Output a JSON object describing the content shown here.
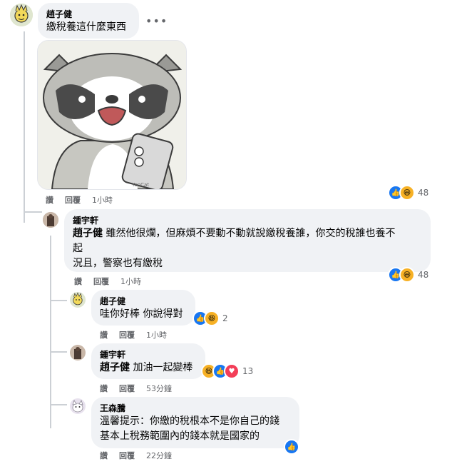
{
  "colors": {
    "like": "#1877f2",
    "haha": "#f7b125",
    "bubble": "#f0f2f5",
    "meta": "#65676b"
  },
  "comments": [
    {
      "author": "趙子健",
      "text": "繳稅養這什麼東西",
      "actions": {
        "like": "讚",
        "reply": "回覆",
        "time": "1小時"
      },
      "reactions": "48"
    },
    {
      "author": "鍾宇軒",
      "mention": "趙子健",
      "line1": "雖然他很爛，但麻煩不要動不動就說繳稅養誰，你交的稅誰也養不",
      "line2": "起",
      "line3": "況且，警察也有繳稅",
      "actions": {
        "like": "讚",
        "reply": "回覆",
        "time": "1小時"
      },
      "reactions": "48"
    },
    {
      "author": "趙子健",
      "text": "哇你好棒 你說得對",
      "actions": {
        "like": "讚",
        "reply": "回覆",
        "time": "1小時"
      },
      "reactions": "2"
    },
    {
      "author": "鍾宇軒",
      "mention": "趙子健",
      "text": "加油一起變棒",
      "actions": {
        "like": "讚",
        "reply": "回覆",
        "time": "53分鐘"
      },
      "reactions": "13"
    },
    {
      "author": "王森騰",
      "line1": "溫馨提示：你繳的稅根本不是你自己的錢",
      "line2": "基本上稅務範圍內的錢本就是國家的",
      "actions": {
        "like": "讚",
        "reply": "回覆",
        "time": "22分鐘"
      }
    }
  ],
  "sticker": {
    "watermark": "YenCat"
  },
  "icons": {
    "more": "more-options-icon",
    "like": "like-icon",
    "haha": "haha-icon"
  }
}
